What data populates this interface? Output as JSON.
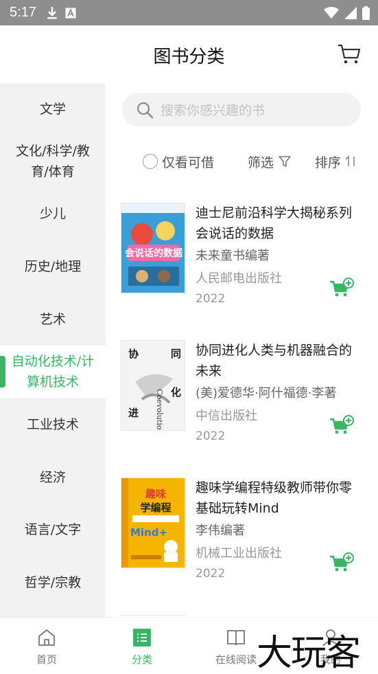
{
  "status_bar": {
    "time": "5:17",
    "icons": [
      "download-icon",
      "text-icon",
      "wifi-icon",
      "signal-icon",
      "battery-icon"
    ]
  },
  "header": {
    "title": "图书分类",
    "cart_icon": "cart-icon"
  },
  "sidebar": {
    "items": [
      {
        "label": "文学"
      },
      {
        "label": "文化/科学/教育/体育"
      },
      {
        "label": "少儿"
      },
      {
        "label": "历史/地理"
      },
      {
        "label": "艺术"
      },
      {
        "label": "自动化技术/计算机技术",
        "active": true
      },
      {
        "label": "工业技术"
      },
      {
        "label": "经济"
      },
      {
        "label": "语言/文字"
      },
      {
        "label": "哲学/宗教"
      }
    ]
  },
  "search": {
    "placeholder": "搜索你感兴趣的书"
  },
  "filters": {
    "only_available": "仅看可借",
    "filter": "筛选",
    "sort": "排序"
  },
  "books": [
    {
      "title": "迪士尼前沿科学大揭秘系列会说话的数据",
      "author": "未来童书编著",
      "publisher": "人民邮电出版社",
      "year": "2022",
      "cover_text": "会说话的数据",
      "cover_color": "#3a9ed8"
    },
    {
      "title": "协同进化人类与机器融合的未来",
      "author": "(美)爱德华·阿什福德·李著",
      "publisher": "中信出版社",
      "year": "2022",
      "cover_text": "协同进化",
      "cover_color": "#f4f4f4"
    },
    {
      "title": "趣味学编程特级教师带你零基础玩转Mind",
      "author": "李伟编著",
      "publisher": "机械工业出版社",
      "year": "2022",
      "cover_text": "趣味学编程",
      "cover_color": "#f5b400"
    }
  ],
  "tabs": [
    {
      "label": "首页",
      "icon": "home-icon"
    },
    {
      "label": "分类",
      "icon": "category-icon",
      "active": true
    },
    {
      "label": "在线阅读",
      "icon": "book-open-icon"
    },
    {
      "label": "我的",
      "icon": "user-icon"
    }
  ],
  "watermark": "大玩客",
  "colors": {
    "accent": "#3bb565",
    "status_bar": "#8e8e8e",
    "sidebar_bg": "#f2f2f2"
  }
}
